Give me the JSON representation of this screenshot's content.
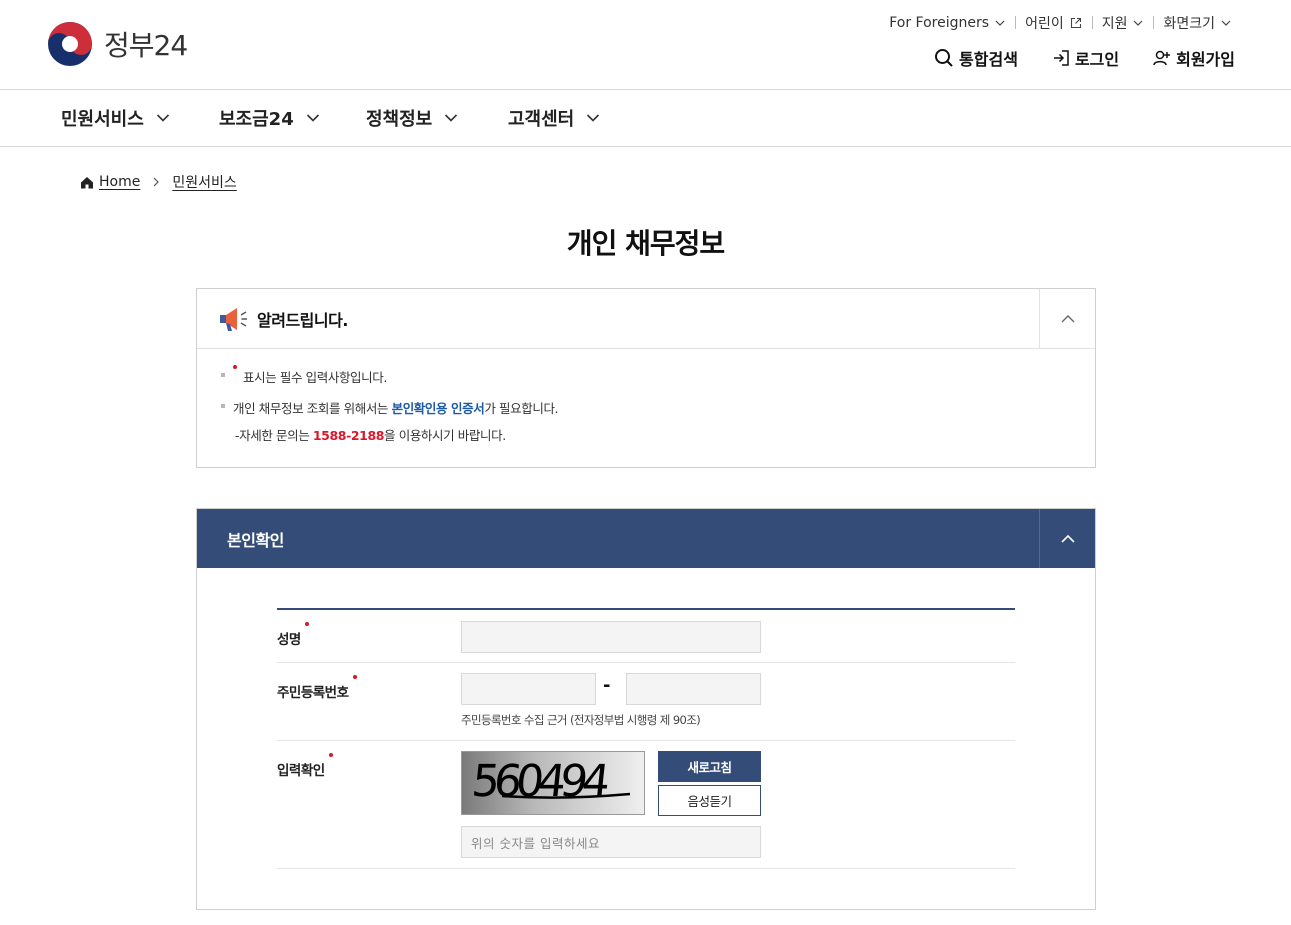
{
  "header": {
    "logo_text": "정부24",
    "utility": [
      {
        "label": "For Foreigners",
        "icon": "chevron-down-icon"
      },
      {
        "label": "어린이",
        "icon": "external-link-icon"
      },
      {
        "label": "지원",
        "icon": "chevron-down-icon"
      },
      {
        "label": "화면크기",
        "icon": "chevron-down-icon"
      }
    ],
    "top_actions": {
      "search": "통합검색",
      "login": "로그인",
      "signup": "회원가입"
    }
  },
  "main_nav": [
    "민원서비스",
    "보조금24",
    "정책정보",
    "고객센터"
  ],
  "breadcrumb": {
    "home": "Home",
    "current": "민원서비스"
  },
  "page_title": "개인 채무정보",
  "notice": {
    "title": "알려드립니다.",
    "line1": "표시는 필수 입력사항입니다.",
    "line2_pre": "개인 채무정보 조회를 위해서는 ",
    "line2_link": "본인확인용 인증서",
    "line2_post": "가 필요합니다.",
    "line3_pre": "자세한 문의는 ",
    "line3_phone": "1588-2188",
    "line3_post": "을 이용하시기 바랍니다."
  },
  "auth": {
    "title": "본인확인",
    "name_label": "성명",
    "rrn_label": "주민등록번호",
    "rrn_dash": "-",
    "rrn_hint": "주민등록번호 수집 근거 (전자정부법 시행령 제 90조)",
    "captcha_label": "입력확인",
    "captcha_text": "560494",
    "refresh_label": "새로고침",
    "audio_label": "음성듣기",
    "captcha_placeholder": "위의 숫자를 입력하세요"
  },
  "colors": {
    "navy": "#344d78",
    "required_red": "#d7192b",
    "link_blue": "#1d5aa8"
  }
}
